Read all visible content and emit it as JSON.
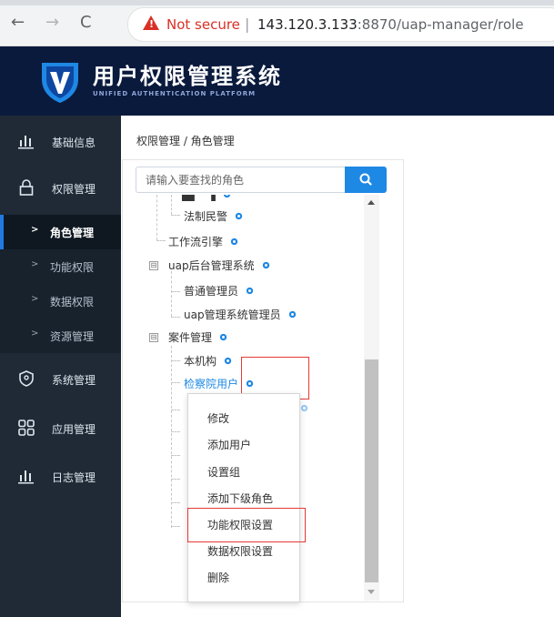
{
  "browser": {
    "security_label": "Not secure",
    "url_host": "143.120.3.133",
    "url_rest": ":8870/uap-manager/role"
  },
  "app": {
    "title": "用户权限管理系统",
    "subtitle": "UNIFIED AUTHENTICATION PLATFORM"
  },
  "sidebar": {
    "items": [
      {
        "label": "基础信息",
        "icon": "bar-chart-icon"
      },
      {
        "label": "权限管理",
        "icon": "lock-icon"
      },
      {
        "label": "系统管理",
        "icon": "shield-icon"
      },
      {
        "label": "应用管理",
        "icon": "grid-icon"
      },
      {
        "label": "日志管理",
        "icon": "bar-chart-icon"
      }
    ],
    "sub_items": [
      {
        "label": "角色管理",
        "active": true
      },
      {
        "label": "功能权限"
      },
      {
        "label": "数据权限"
      },
      {
        "label": "资源管理"
      }
    ],
    "bullet": ">"
  },
  "main": {
    "breadcrumb": "权限管理 / 角色管理",
    "search_placeholder": "请输入要查找的角色",
    "tree": [
      {
        "label": "法制民警"
      },
      {
        "label": "工作流引擎"
      },
      {
        "label": "uap后台管理系统"
      },
      {
        "label": "普通管理员"
      },
      {
        "label": "uap管理系统管理员"
      },
      {
        "label": "案件管理"
      },
      {
        "label": "本机构"
      },
      {
        "label": "检察院用户"
      }
    ],
    "collapse_glyph": "⊟"
  },
  "context_menu": {
    "items": [
      "修改",
      "添加用户",
      "设置组",
      "添加下级角色",
      "功能权限设置",
      "数据权限设置",
      "删除"
    ]
  },
  "colors": {
    "header_bg": "#0a1a3d",
    "sidebar_bg": "#1f2a36",
    "accent": "#1e88e5",
    "highlight": "#e53935"
  }
}
